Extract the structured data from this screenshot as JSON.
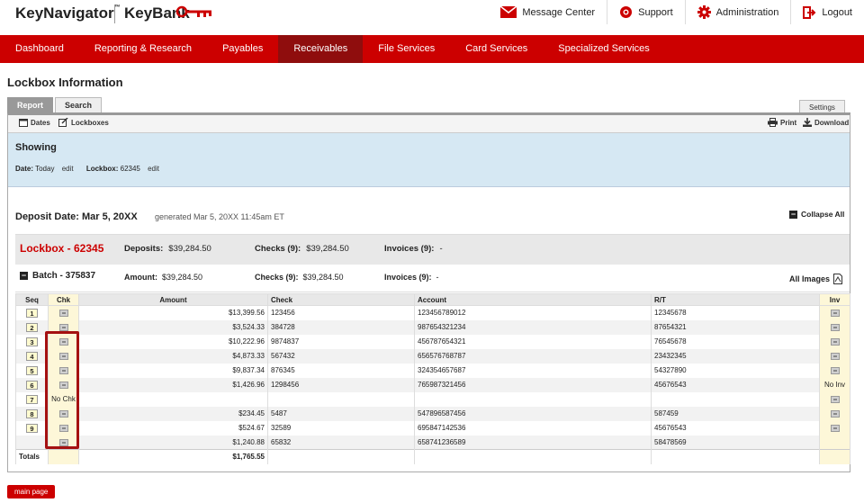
{
  "brand": {
    "kn": "KeyNavigator",
    "tm": "™",
    "kb": "KeyBank",
    "accent": "#cc0000"
  },
  "top_links": {
    "message_center": "Message Center",
    "support": "Support",
    "administration": "Administration",
    "logout": "Logout"
  },
  "nav": [
    "Dashboard",
    "Reporting & Research",
    "Payables",
    "Receivables",
    "File Services",
    "Card Services",
    "Specialized Services"
  ],
  "page": {
    "title": "Lockbox Information"
  },
  "tabs": {
    "report": "Report",
    "search": "Search",
    "settings": "Settings"
  },
  "toolbar": {
    "dates": "Dates",
    "lockboxes": "Lockboxes",
    "print": "Print",
    "download": "Download"
  },
  "showing": {
    "title": "Showing",
    "date_label": "Date:",
    "date_value": "Today",
    "edit": "edit",
    "lockbox_label": "Lockbox:",
    "lockbox_value": "62345"
  },
  "deposit": {
    "title": "Deposit Date: Mar 5, 20XX",
    "generated": "generated Mar 5, 20XX 11:45am ET",
    "collapse": "Collapse All"
  },
  "lockbox": {
    "title": "Lockbox - 62345",
    "deposits_label": "Deposits:",
    "deposits_value": "$39,284.50",
    "checks_label": "Checks (9):",
    "checks_value": "$39,284.50",
    "invoices_label": "Invoices (9):",
    "invoices_value": "-"
  },
  "batch": {
    "title": "Batch - 375837",
    "amount_label": "Amount:",
    "amount_value": "$39,284.50",
    "checks_label": "Checks (9):",
    "checks_value": "$39,284.50",
    "invoices_label": "Invoices (9):",
    "invoices_value": "-",
    "all_images": "All Images"
  },
  "table": {
    "headers": {
      "seq": "Seq",
      "chk": "Chk",
      "amount": "Amount",
      "check": "Check",
      "account": "Account",
      "rt": "R/T",
      "inv": "Inv"
    },
    "rows": [
      {
        "seq": "1",
        "chk": "img",
        "amount": "$13,399.56",
        "check": "123456",
        "account": "123456789012",
        "rt": "12345678",
        "inv": "img"
      },
      {
        "seq": "2",
        "chk": "img",
        "amount": "$3,524.33",
        "check": "384728",
        "account": "987654321234",
        "rt": "87654321",
        "inv": "img"
      },
      {
        "seq": "3",
        "chk": "img",
        "amount": "$10,222.96",
        "check": "9874837",
        "account": "456787654321",
        "rt": "76545678",
        "inv": "img"
      },
      {
        "seq": "4",
        "chk": "img",
        "amount": "$4,873.33",
        "check": "567432",
        "account": "656576768787",
        "rt": "23432345",
        "inv": "img"
      },
      {
        "seq": "5",
        "chk": "img",
        "amount": "$9,837.34",
        "check": "876345",
        "account": "324354657687",
        "rt": "54327890",
        "inv": "img"
      },
      {
        "seq": "6",
        "chk": "img",
        "amount": "$1,426.96",
        "check": "1298456",
        "account": "765987321456",
        "rt": "45676543",
        "inv": "No Inv"
      },
      {
        "seq": "7",
        "chk": "No Chk",
        "amount": "",
        "check": "",
        "account": "",
        "rt": "",
        "inv": "img"
      },
      {
        "seq": "8",
        "chk": "img",
        "amount": "$234.45",
        "check": "5487",
        "account": "547896587456",
        "rt": "587459",
        "inv": "img"
      },
      {
        "seq": "9",
        "chk": "img",
        "amount": "$524.67",
        "check": "32589",
        "account": "695847142536",
        "rt": "45676543",
        "inv": "img"
      },
      {
        "seq": "",
        "chk": "img",
        "amount": "$1,240.88",
        "check": "65832",
        "account": "658741236589",
        "rt": "58478569",
        "inv": ""
      }
    ],
    "totals_label": "Totals",
    "totals_amount": "$1,765.55"
  },
  "footer": {
    "main_page": "main page"
  }
}
